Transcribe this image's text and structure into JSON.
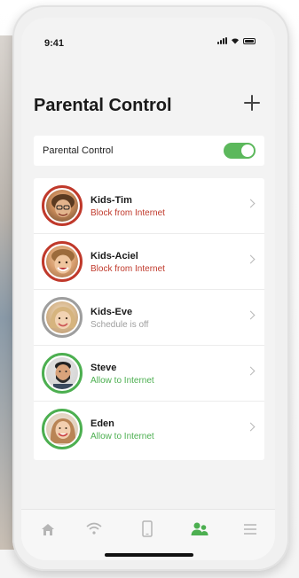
{
  "status_bar": {
    "time": "9:41"
  },
  "header": {
    "title": "Parental Control",
    "add_icon": "plus-icon"
  },
  "parental_toggle": {
    "label": "Parental Control",
    "enabled": true,
    "on_color": "#5cb85c"
  },
  "colors": {
    "blocked": "#c0392b",
    "allowed": "#4caf50",
    "neutral": "#9e9e9e"
  },
  "profiles": [
    {
      "name": "Kids-Tim",
      "status": "Block from Internet",
      "state": "blocked"
    },
    {
      "name": "Kids-Aciel",
      "status": "Block from Internet",
      "state": "blocked"
    },
    {
      "name": "Kids-Eve",
      "status": "Schedule is off",
      "state": "neutral"
    },
    {
      "name": "Steve",
      "status": "Allow to Internet",
      "state": "allowed"
    },
    {
      "name": "Eden",
      "status": "Allow to Internet",
      "state": "allowed"
    }
  ],
  "tab_bar": [
    {
      "icon": "home-icon",
      "active": false
    },
    {
      "icon": "wifi-icon",
      "active": false
    },
    {
      "icon": "phone-device-icon",
      "active": false
    },
    {
      "icon": "people-icon",
      "active": true
    },
    {
      "icon": "menu-icon",
      "active": false
    }
  ]
}
